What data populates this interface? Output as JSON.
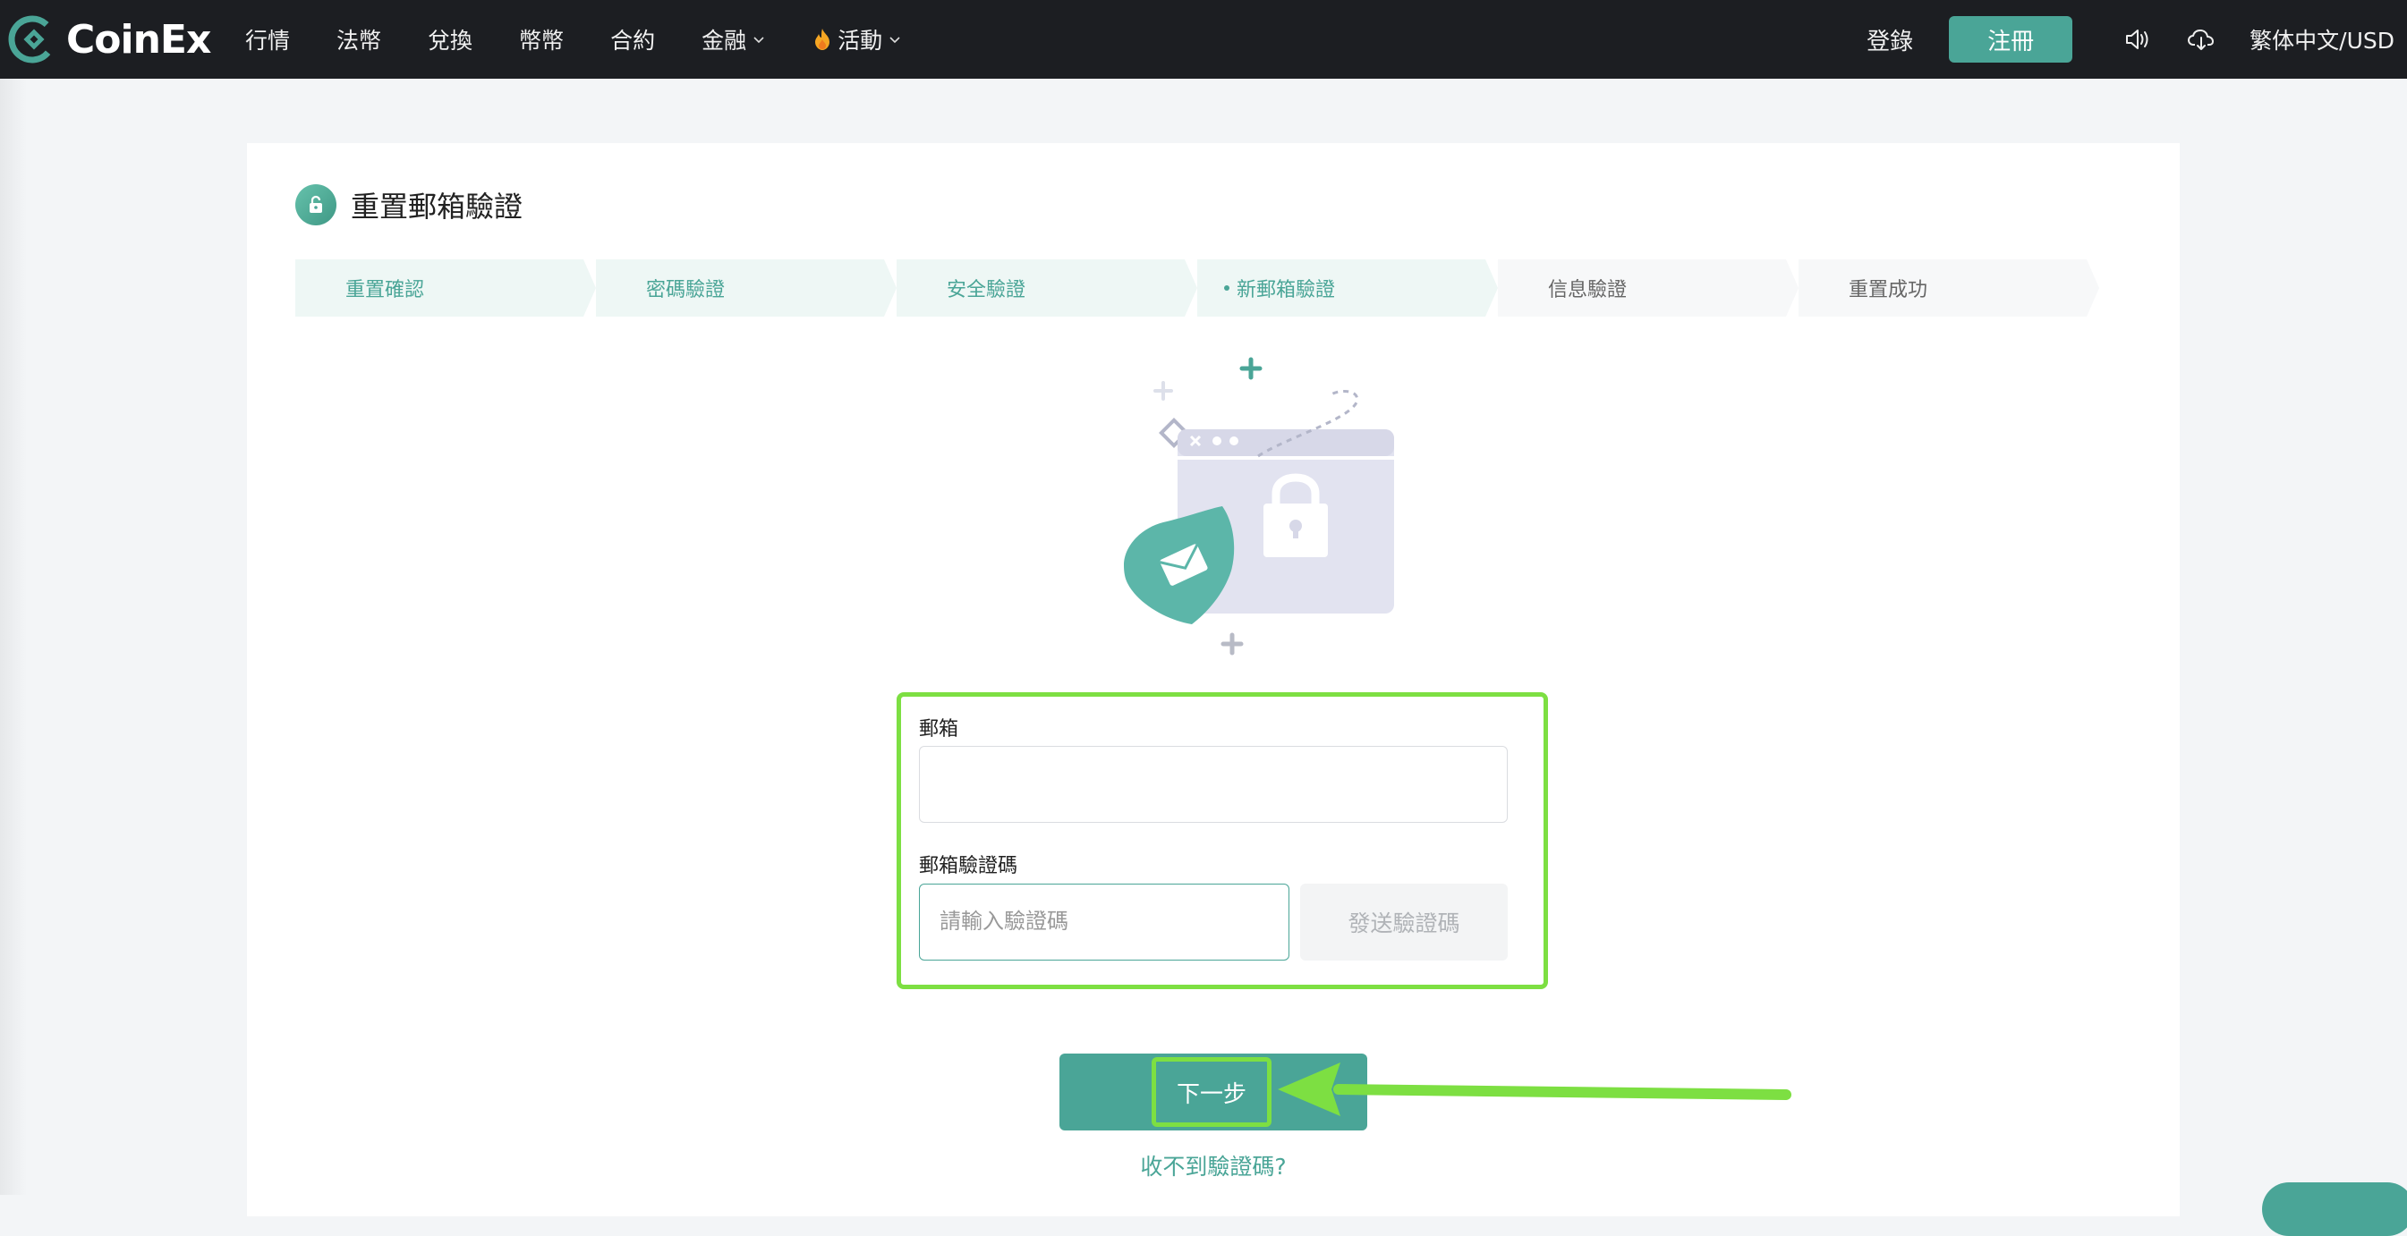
{
  "nav": {
    "brand": "CoinEx",
    "items": [
      {
        "label": "行情",
        "dropdown": false,
        "icon": null
      },
      {
        "label": "法幣",
        "dropdown": false,
        "icon": null
      },
      {
        "label": "兌換",
        "dropdown": false,
        "icon": null
      },
      {
        "label": "幣幣",
        "dropdown": false,
        "icon": null
      },
      {
        "label": "合約",
        "dropdown": false,
        "icon": null
      },
      {
        "label": "金融",
        "dropdown": true,
        "icon": null
      },
      {
        "label": "活動",
        "dropdown": true,
        "icon": "fire-icon"
      }
    ],
    "login": "登錄",
    "register": "注冊",
    "language": "繁体中文/USD"
  },
  "page": {
    "title": "重置郵箱驗證",
    "steps": [
      {
        "label": "重置確認",
        "state": "done"
      },
      {
        "label": "密碼驗證",
        "state": "done"
      },
      {
        "label": "安全驗證",
        "state": "done"
      },
      {
        "label": "新郵箱驗證",
        "state": "current"
      },
      {
        "label": "信息驗證",
        "state": "todo"
      },
      {
        "label": "重置成功",
        "state": "todo"
      }
    ]
  },
  "form": {
    "email_label": "郵箱",
    "email_value": "",
    "code_label": "郵箱驗證碼",
    "code_placeholder": "請輸入驗證碼",
    "send_code": "發送驗證碼",
    "next": "下一步",
    "no_code": "收不到驗證碼?"
  },
  "colors": {
    "accent": "#4aa597",
    "nav_bg": "#1c1e22",
    "highlight": "#7ddf42"
  }
}
